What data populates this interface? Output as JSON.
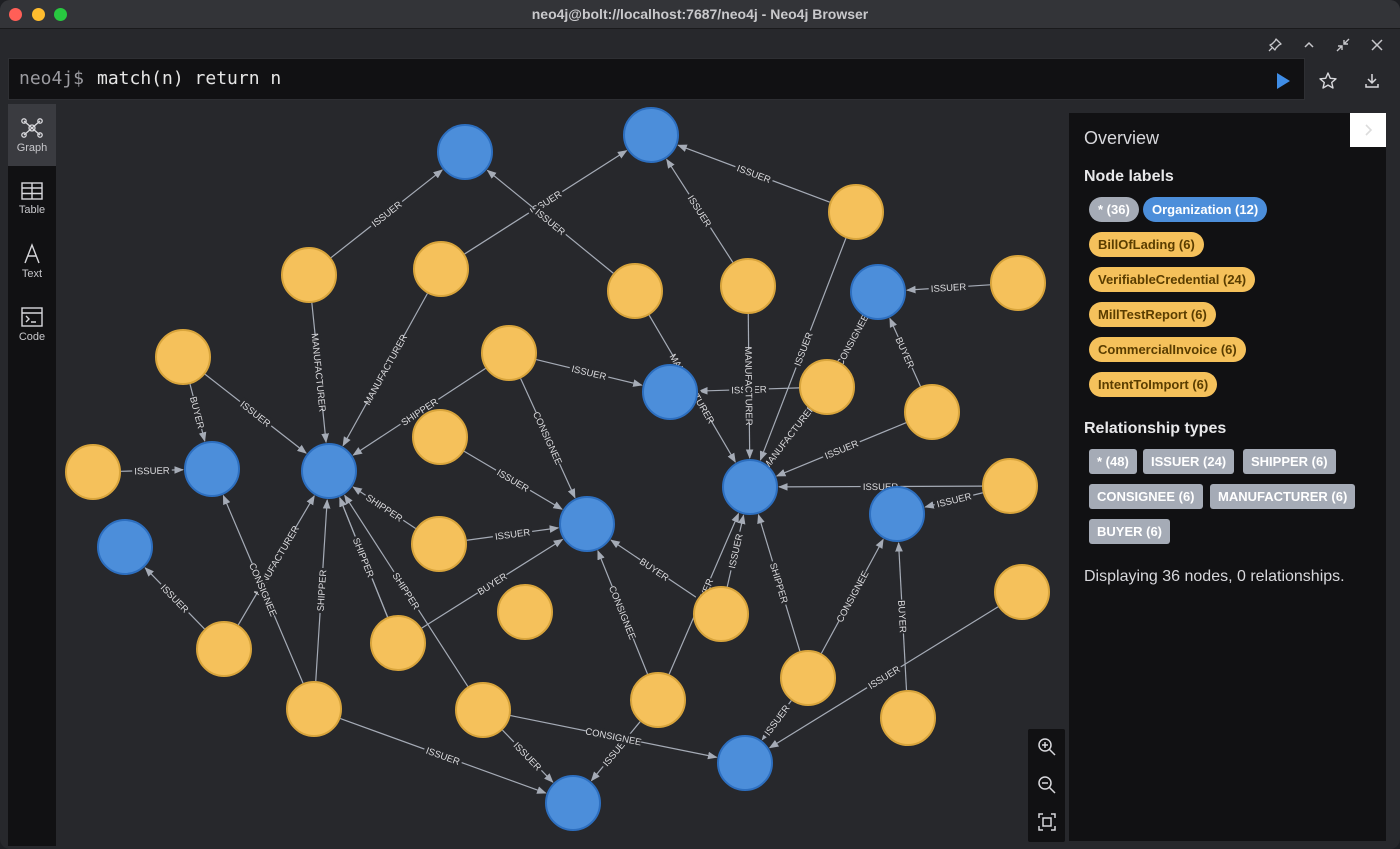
{
  "window": {
    "title": "neo4j@bolt://localhost:7687/neo4j - Neo4j Browser"
  },
  "frame_controls": [
    "pin-icon",
    "chevron-up-icon",
    "collapse-icon",
    "close-icon"
  ],
  "editor": {
    "prompt": "neo4j$",
    "query": "match(n) return n"
  },
  "left_toolbar": [
    {
      "label": "Graph",
      "icon": "graph-icon",
      "active": true
    },
    {
      "label": "Table",
      "icon": "table-icon",
      "active": false
    },
    {
      "label": "Text",
      "icon": "text-icon",
      "active": false
    },
    {
      "label": "Code",
      "icon": "code-icon",
      "active": false
    }
  ],
  "overview": {
    "title": "Overview",
    "node_labels_heading": "Node labels",
    "node_labels": [
      {
        "text": "* (36)",
        "bg": "#a5abb6",
        "fg": "#ffffff"
      },
      {
        "text": "Organization (12)",
        "bg": "#4c8eda",
        "fg": "#ffffff"
      },
      {
        "text": "BillOfLading (6)",
        "bg": "#f5c15b",
        "fg": "#5a3d00"
      },
      {
        "text": "VerifiableCredential (24)",
        "bg": "#f5c15b",
        "fg": "#5a3d00"
      },
      {
        "text": "MillTestReport (6)",
        "bg": "#f5c15b",
        "fg": "#5a3d00"
      },
      {
        "text": "CommercialInvoice (6)",
        "bg": "#f5c15b",
        "fg": "#5a3d00"
      },
      {
        "text": "IntentToImport (6)",
        "bg": "#f5c15b",
        "fg": "#5a3d00"
      }
    ],
    "relationship_types_heading": "Relationship types",
    "relationship_types": [
      "* (48)",
      "ISSUER (24)",
      "SHIPPER (6)",
      "CONSIGNEE (6)",
      "MANUFACTURER (6)",
      "BUYER (6)"
    ],
    "status": "Displaying 36 nodes, 0 relationships."
  },
  "zoom_controls": [
    "zoom-in-icon",
    "zoom-out-icon",
    "fit-screen-icon"
  ],
  "colors": {
    "organization": "#4c8eda",
    "organization_stroke": "#2d6fc0",
    "credential": "#f5c15b",
    "credential_stroke": "#d9a53c",
    "edge": "#a5abb6"
  },
  "graph": {
    "edges": [
      {
        "label": "ISSUER"
      },
      {
        "label": "ISSUER"
      },
      {
        "label": "ISSUER"
      },
      {
        "label": "ISSUER"
      },
      {
        "label": "ISSUER"
      },
      {
        "label": "ISSUER"
      },
      {
        "label": "ISSUER"
      },
      {
        "label": "ISSUER"
      },
      {
        "label": "ISSUER"
      },
      {
        "label": "ISSUER"
      },
      {
        "label": "ISSUER"
      },
      {
        "label": "ISSUER"
      },
      {
        "label": "ISSUER"
      },
      {
        "label": "ISSUER"
      },
      {
        "label": "ISSUER"
      },
      {
        "label": "ISSUER"
      },
      {
        "label": "ISSUER"
      },
      {
        "label": "ISSUER"
      },
      {
        "label": "ISSUER"
      },
      {
        "label": "ISSUER"
      },
      {
        "label": "ISSUER"
      },
      {
        "label": "ISSUER"
      },
      {
        "label": "ISSUER"
      },
      {
        "label": "ISSUER"
      },
      {
        "label": "MANUFACTURER"
      },
      {
        "label": "MANUFACTURER"
      },
      {
        "label": "MANUFACTURER"
      },
      {
        "label": "MANUFACTURER"
      },
      {
        "label": "MANUFACTURER"
      },
      {
        "label": "MANUFACTURER"
      },
      {
        "label": "SHIPPER"
      },
      {
        "label": "SHIPPER"
      },
      {
        "label": "SHIPPER"
      },
      {
        "label": "SHIPPER"
      },
      {
        "label": "SHIPPER"
      },
      {
        "label": "SHIPPER"
      },
      {
        "label": "CONSIGNEE"
      },
      {
        "label": "CONSIGNEE"
      },
      {
        "label": "CONSIGNEE"
      },
      {
        "label": "CONSIGNEE"
      },
      {
        "label": "CONSIGNEE"
      },
      {
        "label": "CONSIGNEE"
      },
      {
        "label": "BUYER"
      },
      {
        "label": "BUYER"
      },
      {
        "label": "BUYER"
      },
      {
        "label": "BUYER"
      },
      {
        "label": "BUYER"
      },
      {
        "label": "BUYER"
      }
    ]
  }
}
